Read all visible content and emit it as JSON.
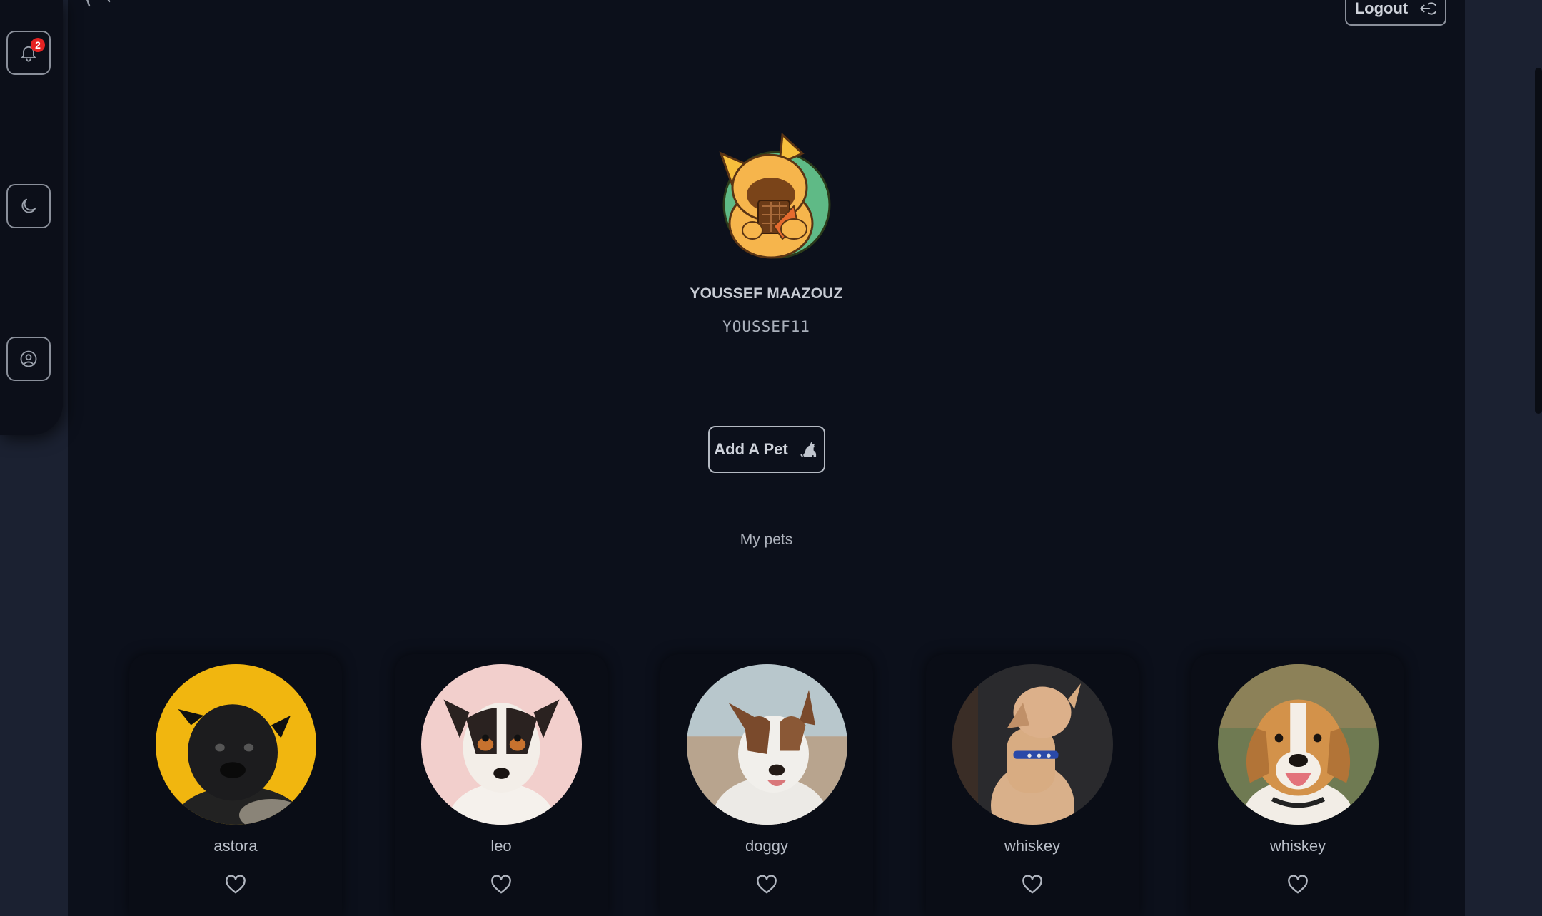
{
  "sidebar": {
    "notifications": {
      "icon": "bell-icon",
      "count": "2"
    },
    "theme": {
      "icon": "moon-icon"
    },
    "profile": {
      "icon": "user-circle-icon"
    }
  },
  "header": {
    "back_icon": "back-arrow-icon",
    "logout_label": "Logout",
    "logout_icon": "logout-icon"
  },
  "profile": {
    "full_name": "YOUSSEF MAAZOUZ",
    "username": "YOUSSEF11"
  },
  "actions": {
    "add_pet_label": "Add A Pet",
    "add_pet_icon": "dog-icon"
  },
  "pets_section": {
    "title": "My pets",
    "pets": [
      {
        "name": "astora",
        "icon": "heart-icon"
      },
      {
        "name": "leo",
        "icon": "heart-icon"
      },
      {
        "name": "doggy",
        "icon": "heart-icon"
      },
      {
        "name": "whiskey",
        "icon": "heart-icon"
      },
      {
        "name": "whiskey",
        "icon": "heart-icon"
      }
    ]
  },
  "colors": {
    "page_bg": "#1b2131",
    "main_bg": "#0c101b",
    "card_bg": "#0a0d16",
    "badge": "#e52222"
  }
}
